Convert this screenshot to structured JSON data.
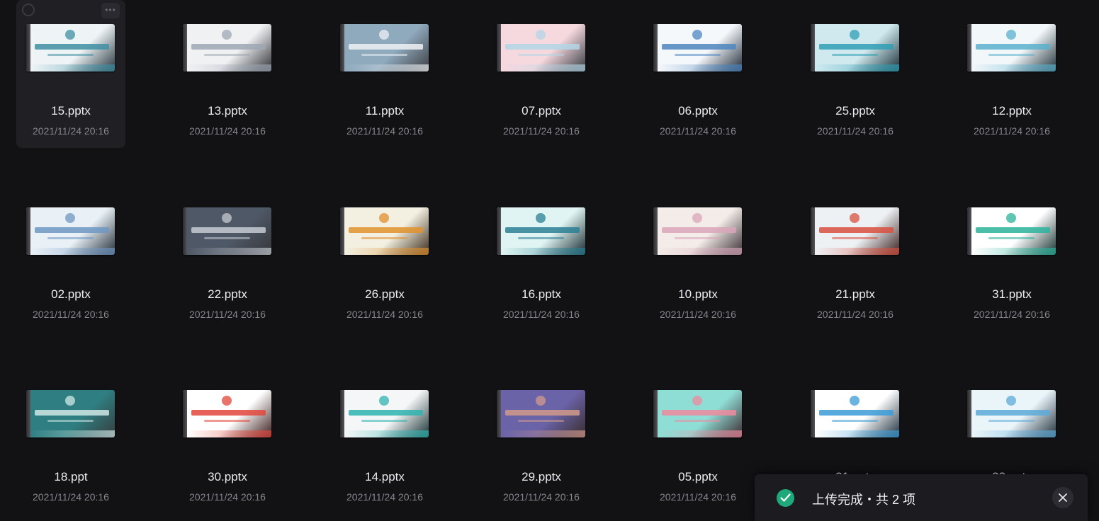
{
  "files": [
    {
      "name": "15.pptx",
      "date": "2021/11/24 20:16",
      "thumb_colors": [
        "#eef4f6",
        "#3f8fa3"
      ],
      "selected": true
    },
    {
      "name": "13.pptx",
      "date": "2021/11/24 20:16",
      "thumb_colors": [
        "#f0f1f3",
        "#9ea7b4"
      ]
    },
    {
      "name": "11.pptx",
      "date": "2021/11/24 20:16",
      "thumb_colors": [
        "#8fa9bd",
        "#eef2f5"
      ]
    },
    {
      "name": "07.pptx",
      "date": "2021/11/24 20:16",
      "thumb_colors": [
        "#f6d8df",
        "#b3d6e6"
      ]
    },
    {
      "name": "06.pptx",
      "date": "2021/11/24 20:16",
      "thumb_colors": [
        "#f5f8fb",
        "#4d86c0"
      ]
    },
    {
      "name": "25.pptx",
      "date": "2021/11/24 20:16",
      "thumb_colors": [
        "#cfe9ef",
        "#2f9fb5"
      ]
    },
    {
      "name": "12.pptx",
      "date": "2021/11/24 20:16",
      "thumb_colors": [
        "#f2f7fa",
        "#5ab0cd"
      ]
    },
    {
      "name": "02.pptx",
      "date": "2021/11/24 20:16",
      "thumb_colors": [
        "#e9f1f7",
        "#6f96c2"
      ]
    },
    {
      "name": "22.pptx",
      "date": "2021/11/24 20:16",
      "thumb_colors": [
        "#4f5866",
        "#c5cad2"
      ]
    },
    {
      "name": "26.pptx",
      "date": "2021/11/24 20:16",
      "thumb_colors": [
        "#f3efe1",
        "#e0902e"
      ]
    },
    {
      "name": "16.pptx",
      "date": "2021/11/24 20:16",
      "thumb_colors": [
        "#e0f5f3",
        "#2a7f93"
      ]
    },
    {
      "name": "10.pptx",
      "date": "2021/11/24 20:16",
      "thumb_colors": [
        "#f3ece8",
        "#d9a6ba"
      ]
    },
    {
      "name": "21.pptx",
      "date": "2021/11/24 20:16",
      "thumb_colors": [
        "#eef1f4",
        "#d8503f"
      ]
    },
    {
      "name": "31.pptx",
      "date": "2021/11/24 20:16",
      "thumb_colors": [
        "#ffffff",
        "#2bb39b"
      ]
    },
    {
      "name": "18.ppt",
      "date": "2021/11/24 20:16",
      "thumb_colors": [
        "#2f7f82",
        "#cfe8e6"
      ]
    },
    {
      "name": "30.pptx",
      "date": "2021/11/24 20:16",
      "thumb_colors": [
        "#ffffff",
        "#e2463b"
      ]
    },
    {
      "name": "14.pptx",
      "date": "2021/11/24 20:16",
      "thumb_colors": [
        "#f5f6f7",
        "#2fb3b0"
      ]
    },
    {
      "name": "29.pptx",
      "date": "2021/11/24 20:16",
      "thumb_colors": [
        "#6b63a8",
        "#d29a8b"
      ]
    },
    {
      "name": "05.pptx",
      "date": "2021/11/24 20:16",
      "thumb_colors": [
        "#8fded6",
        "#ef8a9e"
      ]
    },
    {
      "name": "21.pptx",
      "date": "",
      "thumb_colors": [
        "#ffffff",
        "#3b9bd6"
      ]
    },
    {
      "name": "23.pptx",
      "date": "",
      "thumb_colors": [
        "#eaf5fa",
        "#5ca9d8"
      ]
    }
  ],
  "tile_more_icon": "ellipsis-icon",
  "tile_select_icon": "circle-checkbox-icon",
  "toast": {
    "message": "上传完成・共 2 项",
    "status_icon": "check-circle-icon",
    "close_icon": "close-icon",
    "accent_color": "#1fa87a"
  }
}
